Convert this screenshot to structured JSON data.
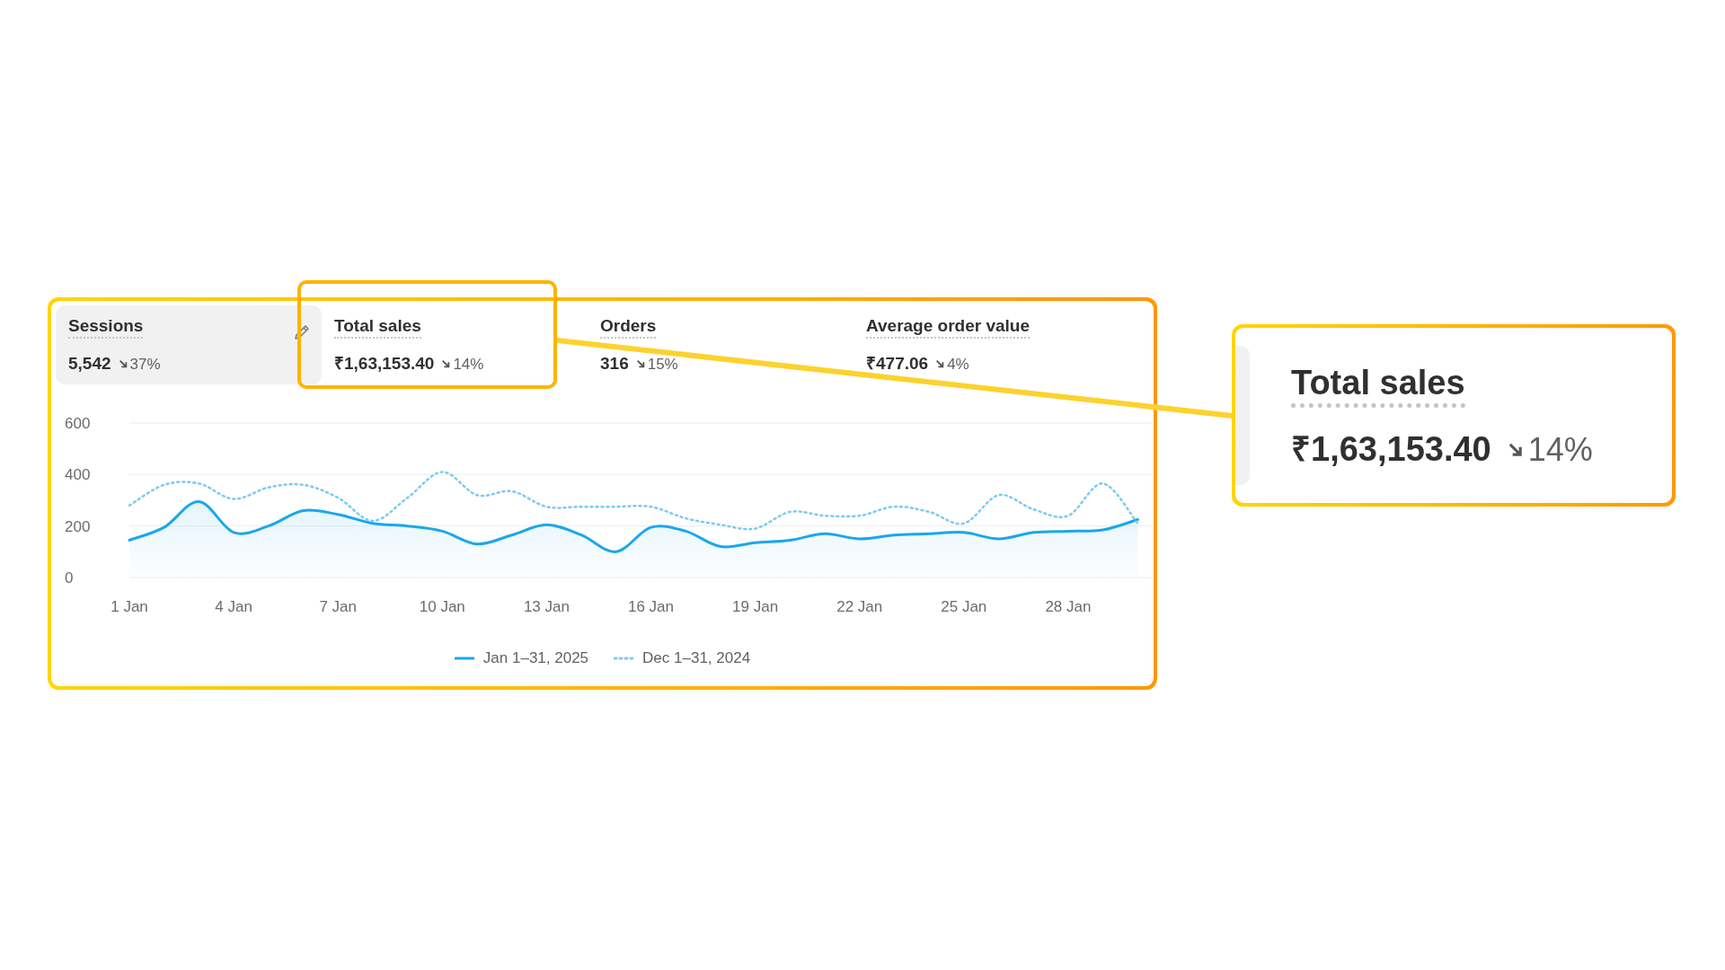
{
  "metrics": [
    {
      "label": "Sessions",
      "value": "5,542",
      "change": "37%",
      "selected": true
    },
    {
      "label": "Total sales",
      "value": "₹1,63,153.40",
      "change": "14%",
      "selected": false
    },
    {
      "label": "Orders",
      "value": "316",
      "change": "15%",
      "selected": false
    },
    {
      "label": "Average order value",
      "value": "₹477.06",
      "change": "4%",
      "selected": false
    }
  ],
  "chart_data": {
    "type": "line",
    "categories": [
      "1 Jan",
      null,
      null,
      "4 Jan",
      null,
      null,
      "7 Jan",
      null,
      null,
      "10 Jan",
      null,
      null,
      "13 Jan",
      null,
      null,
      "16 Jan",
      null,
      null,
      "19 Jan",
      null,
      null,
      "22 Jan",
      null,
      null,
      "25 Jan",
      null,
      null,
      "28 Jan",
      null,
      null,
      null
    ],
    "ylim": [
      0,
      600
    ],
    "yticks": [
      0,
      200,
      400,
      600
    ],
    "series": [
      {
        "name": "Jan 1–31, 2025",
        "color": "#1aa7ec",
        "line_style": "solid",
        "values": [
          145,
          195,
          295,
          175,
          200,
          260,
          245,
          210,
          200,
          180,
          130,
          165,
          205,
          165,
          100,
          195,
          180,
          120,
          135,
          145,
          170,
          150,
          165,
          170,
          175,
          150,
          175,
          180,
          185,
          225,
          null
        ]
      },
      {
        "name": "Dec 1–31, 2024",
        "color": "#7ccaf0",
        "line_style": "dotted",
        "values": [
          280,
          360,
          365,
          305,
          350,
          360,
          310,
          220,
          310,
          410,
          320,
          335,
          275,
          275,
          275,
          275,
          230,
          205,
          190,
          255,
          240,
          240,
          275,
          255,
          210,
          320,
          265,
          240,
          365,
          210,
          null
        ]
      }
    ]
  },
  "callout": {
    "label": "Total sales",
    "value": "₹1,63,153.40",
    "change": "14%"
  }
}
